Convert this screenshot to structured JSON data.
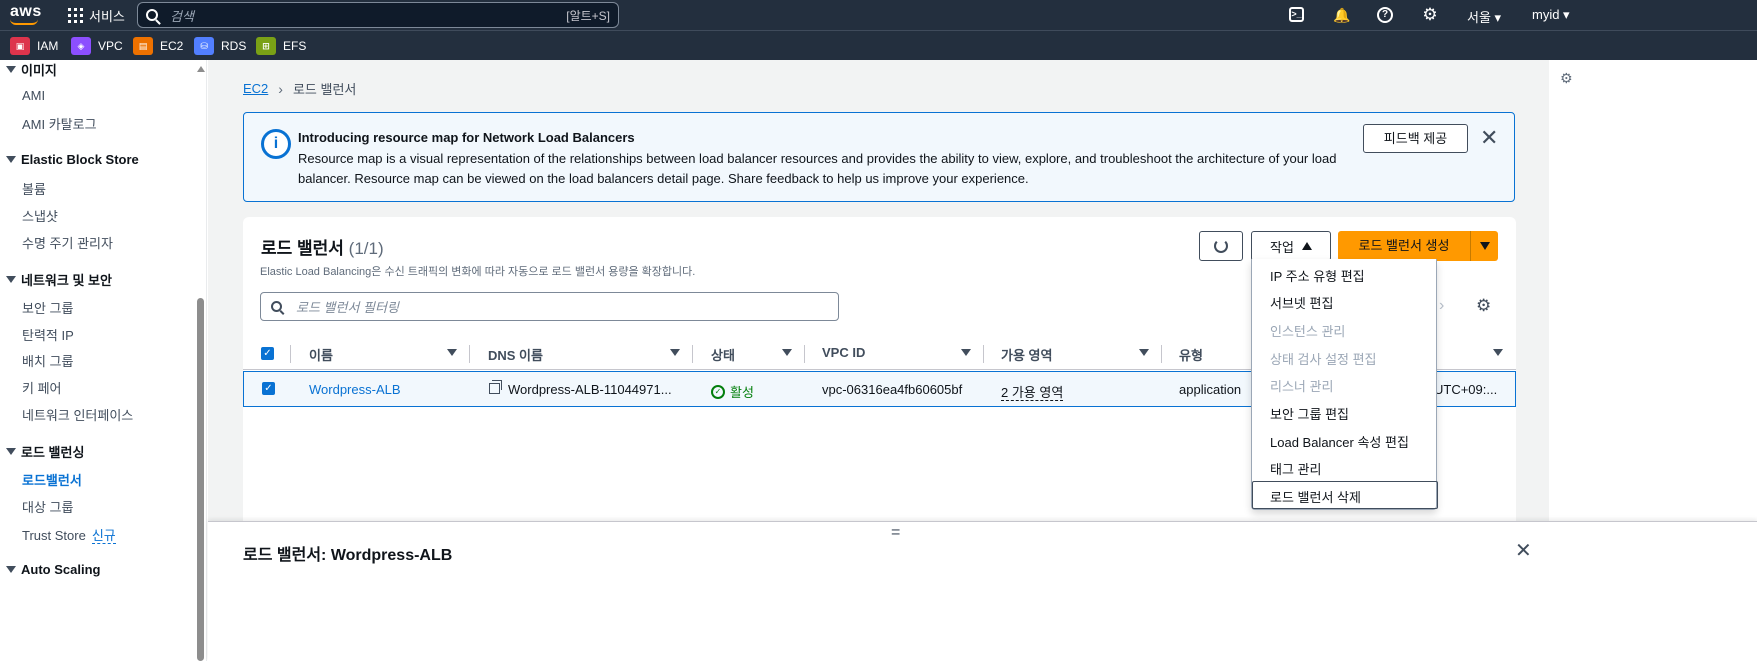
{
  "topnav": {
    "logo": "aws",
    "services_label": "서비스",
    "search_placeholder": "검색",
    "search_shortcut": "[알트+S]",
    "region": "서울 ▾",
    "account": "myid ▾"
  },
  "favorites": [
    {
      "label": "IAM",
      "icon": "iam-icon",
      "color": "#dd344c"
    },
    {
      "label": "VPC",
      "icon": "vpc-icon",
      "color": "#8c4fff"
    },
    {
      "label": "EC2",
      "icon": "ec2-icon",
      "color": "#ed7100"
    },
    {
      "label": "RDS",
      "icon": "rds-icon",
      "color": "#527fff"
    },
    {
      "label": "EFS",
      "icon": "efs-icon",
      "color": "#7aa116"
    }
  ],
  "sidebar": {
    "sections": [
      {
        "title": "이미지",
        "items": [
          "AMI",
          "AMI 카탈로그"
        ]
      },
      {
        "title": "Elastic Block Store",
        "items": [
          "볼륨",
          "스냅샷",
          "수명 주기 관리자"
        ]
      },
      {
        "title": "네트워크 및 보안",
        "items": [
          "보안 그룹",
          "탄력적 IP",
          "배치 그룹",
          "키 페어",
          "네트워크 인터페이스"
        ]
      },
      {
        "title": "로드 밸런싱",
        "items": [
          "로드밸런서",
          "대상 그룹",
          "Trust Store"
        ]
      },
      {
        "title": "Auto Scaling",
        "items": []
      }
    ],
    "new_badge": "신규"
  },
  "breadcrumb": {
    "root": "EC2",
    "current": "로드 밸런서"
  },
  "flash": {
    "title": "Introducing resource map for Network Load Balancers",
    "body": "Resource map is a visual representation of the relationships between load balancer resources and provides the ability to view, explore, and troubleshoot the architecture of your load balancer. Resource map can be viewed on the load balancers detail page. Share feedback to help us improve your experience.",
    "feedback_button": "피드백 제공"
  },
  "panel": {
    "title": "로드 밸런서",
    "count": "(1/1)",
    "description": "Elastic Load Balancing은 수신 트래픽의 변화에 따라 자동으로 로드 밸런서 용량을 확장합니다.",
    "actions_label": "작업",
    "create_label": "로드 밸런서 생성",
    "filter_placeholder": "로드 밸런서 필터링"
  },
  "table": {
    "columns": [
      "이름",
      "DNS 이름",
      "상태",
      "VPC ID",
      "가용 영역",
      "유형"
    ],
    "rows": [
      {
        "name": "Wordpress-ALB",
        "dns": "Wordpress-ALB-11044971...",
        "state": "활성",
        "vpc_id": "vpc-06316ea4fb60605bf",
        "az": "2 가용 영역",
        "type": "application",
        "created": "UTC+09:..."
      }
    ]
  },
  "actions_menu": [
    {
      "label": "IP 주소 유형 편집",
      "disabled": false
    },
    {
      "label": "서브넷 편집",
      "disabled": false
    },
    {
      "label": "인스턴스 관리",
      "disabled": true
    },
    {
      "label": "상태 검사 설정 편집",
      "disabled": true
    },
    {
      "label": "리스너 관리",
      "disabled": true
    },
    {
      "label": "보안 그룹 편집",
      "disabled": false
    },
    {
      "label": "Load Balancer 속성 편집",
      "disabled": false
    },
    {
      "label": "태그 관리",
      "disabled": false
    },
    {
      "label": "로드 밸런서 삭제",
      "disabled": false
    }
  ],
  "split_panel": {
    "title": "로드 밸런서: Wordpress-ALB",
    "handle": "="
  }
}
